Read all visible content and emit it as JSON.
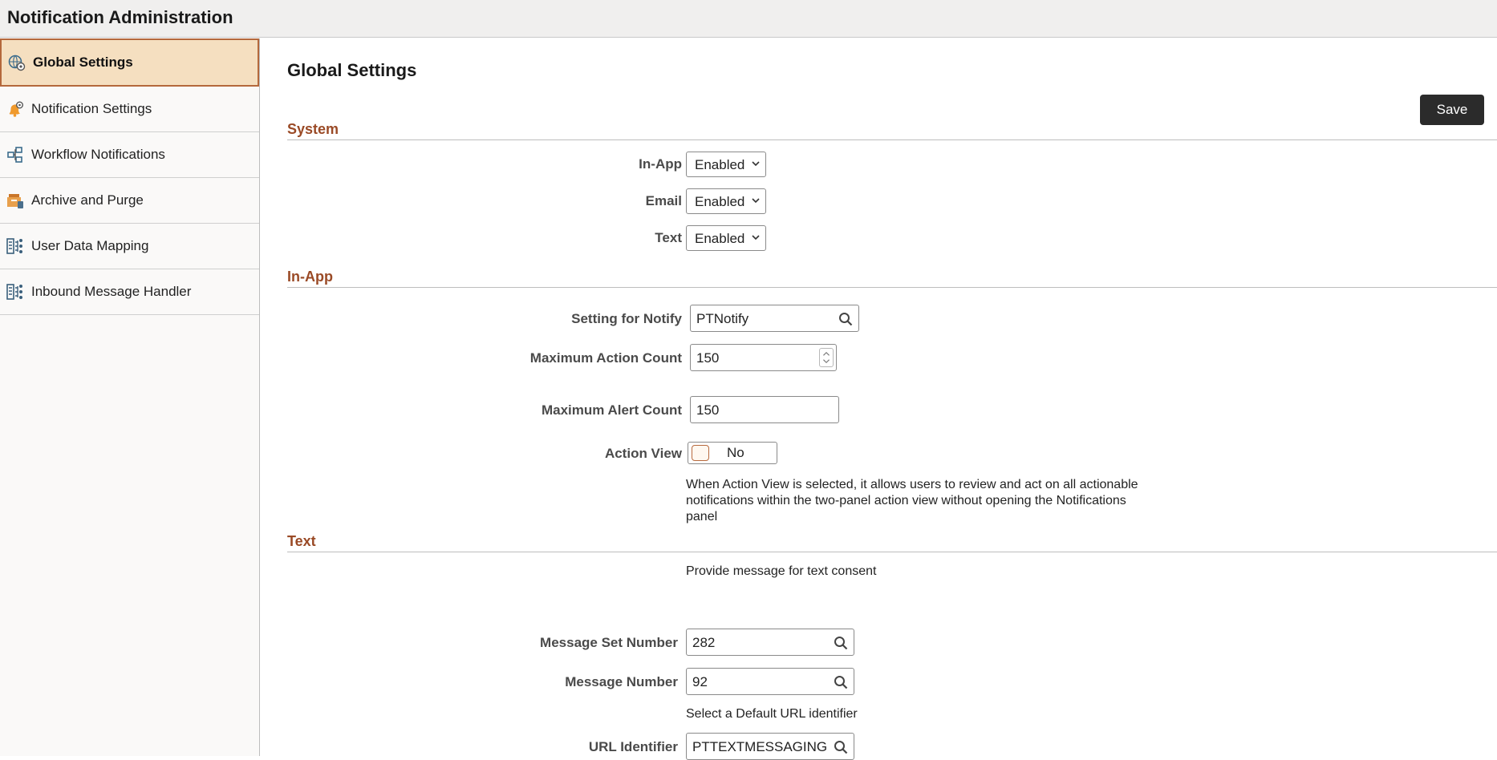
{
  "app": {
    "title": "Notification Administration"
  },
  "sidebar": {
    "items": [
      {
        "label": "Global Settings",
        "icon": "global-settings-icon",
        "active": true
      },
      {
        "label": "Notification Settings",
        "icon": "bell-gear-icon",
        "active": false
      },
      {
        "label": "Workflow Notifications",
        "icon": "workflow-icon",
        "active": false
      },
      {
        "label": "Archive and Purge",
        "icon": "archive-icon",
        "active": false
      },
      {
        "label": "User Data Mapping",
        "icon": "data-mapping-icon",
        "active": false
      },
      {
        "label": "Inbound Message Handler",
        "icon": "message-handler-icon",
        "active": false
      }
    ]
  },
  "main": {
    "title": "Global Settings",
    "save_label": "Save",
    "system": {
      "heading": "System",
      "in_app_label": "In-App",
      "in_app_value": "Enabled",
      "email_label": "Email",
      "email_value": "Enabled",
      "text_label": "Text",
      "text_value": "Enabled"
    },
    "inapp": {
      "heading": "In-App",
      "notify_label": "Setting for Notify",
      "notify_value": "PTNotify",
      "max_action_label": "Maximum Action Count",
      "max_action_value": "150",
      "max_alert_label": "Maximum Alert Count",
      "max_alert_value": "150",
      "action_view_label": "Action View",
      "action_view_value": "No",
      "action_view_help": "When Action View is selected, it allows users to review and act on all actionable notifications within the two-panel action view without opening the Notifications panel"
    },
    "text": {
      "heading": "Text",
      "consent_help": "Provide message for text consent",
      "msg_set_label": "Message Set Number",
      "msg_set_value": "282",
      "msg_num_label": "Message Number",
      "msg_num_value": "92",
      "url_help": "Select a Default URL identifier",
      "url_label": "URL Identifier",
      "url_value": "PTTEXTMESSAGING"
    }
  },
  "colors": {
    "accent": "#9a4a26",
    "active_bg": "#f5dfc0",
    "active_border": "#b4683c",
    "save_bg": "#2b2b2b"
  }
}
